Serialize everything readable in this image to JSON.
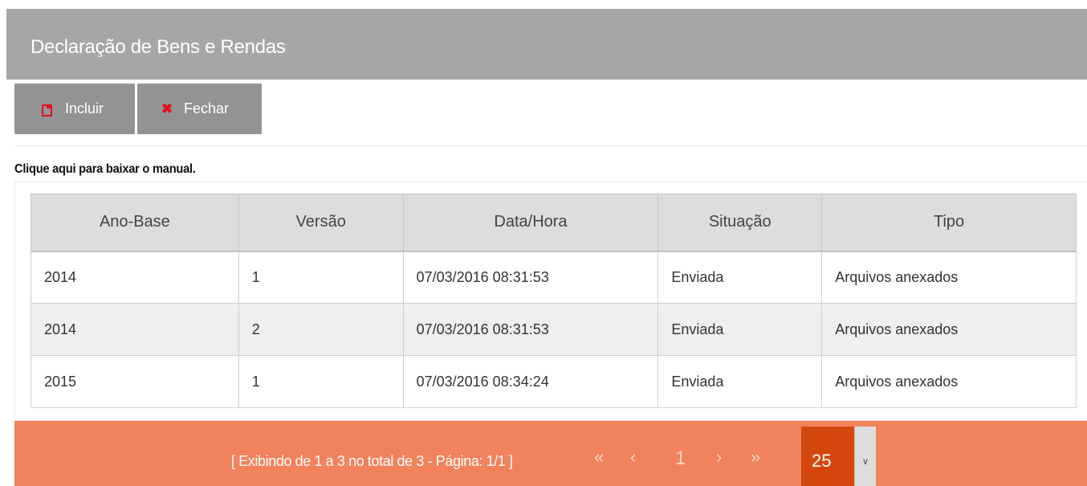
{
  "header": {
    "title": "Declaração de Bens e Rendas"
  },
  "toolbar": {
    "incluir_label": "Incluir",
    "fechar_label": "Fechar"
  },
  "manual_link": "Clique aqui para baixar o manual.",
  "table": {
    "columns": [
      "Ano-Base",
      "Versão",
      "Data/Hora",
      "Situação",
      "Tipo"
    ],
    "rows": [
      [
        "2014",
        "1",
        "07/03/2016 08:31:53",
        "Enviada",
        "Arquivos anexados"
      ],
      [
        "2014",
        "2",
        "07/03/2016 08:31:53",
        "Enviada",
        "Arquivos anexados"
      ],
      [
        "2015",
        "1",
        "07/03/2016 08:34:24",
        "Enviada",
        "Arquivos anexados"
      ]
    ]
  },
  "pager": {
    "info": "[ Exibindo de 1 a 3 no total de 3 - Página: 1/1 ]",
    "first": "«",
    "prev": "‹",
    "current_page": "1",
    "next": "›",
    "last": "»",
    "page_size": "25"
  },
  "colors": {
    "header_bg": "#a6a6a6",
    "button_bg": "#939393",
    "icon_red": "#e0101a",
    "pager_bg": "#f1825c",
    "page_size_bg": "#d4470c"
  }
}
